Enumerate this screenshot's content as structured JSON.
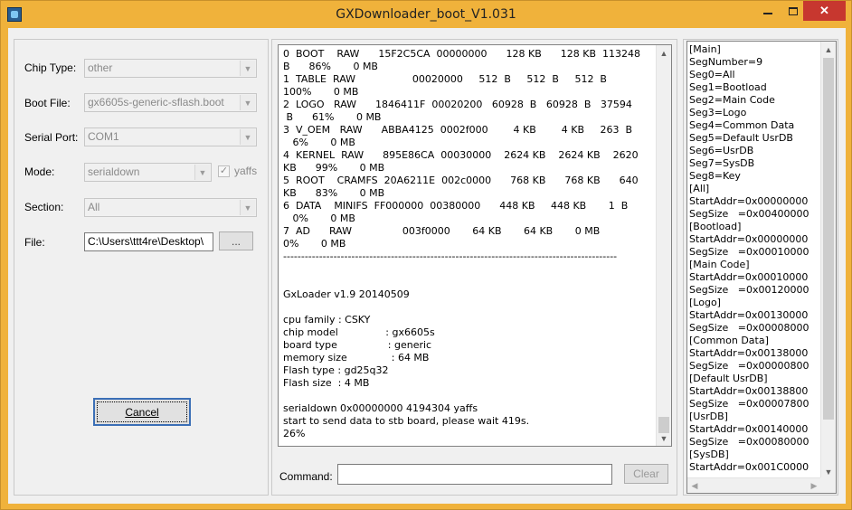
{
  "window": {
    "title": "GXDownloader_boot_V1.031",
    "minimize_label": "",
    "close_label": "✕"
  },
  "settings": {
    "chip_type_label": "Chip Type:",
    "chip_type_value": "other",
    "boot_file_label": "Boot File:",
    "boot_file_value": "gx6605s-generic-sflash.boot",
    "serial_port_label": "Serial Port:",
    "serial_port_value": "COM1",
    "mode_label": "Mode:",
    "mode_value": "serialdown",
    "yaffs_label": "yaffs",
    "yaffs_checked": true,
    "section_label": "Section:",
    "section_value": "All",
    "file_label": "File:",
    "file_value": "C:\\Users\\ttt4re\\Desktop\\",
    "browse_label": "...",
    "cancel_label": "Cancel"
  },
  "log": {
    "lines": [
      "0  BOOT    RAW      15F2C5CA  00000000      128 KB      128 KB  113248",
      "B      86%       0 MB",
      "1  TABLE  RAW                  00020000     512  B     512  B     512  B",
      "100%       0 MB",
      "2  LOGO   RAW      1846411F  00020200   60928  B   60928  B   37594",
      " B      61%       0 MB",
      "3  V_OEM   RAW      ABBA4125  0002f000        4 KB        4 KB     263  B",
      "   6%       0 MB",
      "4  KERNEL  RAW      895E86CA  00030000    2624 KB    2624 KB    2620",
      "KB      99%       0 MB",
      "5  ROOT    CRAMFS  20A6211E  002c0000      768 KB      768 KB      640",
      "KB      83%       0 MB",
      "6  DATA    MINIFS  FF000000  00380000      448 KB     448 KB       1  B",
      "   0%       0 MB",
      "7  AD      RAW                003f0000       64 KB       64 KB       0 MB",
      "0%       0 MB",
      "---------------------------------------------------------------------------------------------",
      "",
      "",
      "GxLoader v1.9 20140509",
      "",
      "cpu family : CSKY",
      "chip model               : gx6605s",
      "board type                : generic",
      "memory size              : 64 MB",
      "Flash type : gd25q32",
      "Flash size  : 4 MB",
      "",
      "serialdown 0x00000000 4194304 yaffs",
      "start to send data to stb board, please wait 419s.",
      "26%"
    ]
  },
  "command": {
    "label": "Command:",
    "value": "",
    "clear_label": "Clear"
  },
  "config": {
    "lines": [
      "[Main]",
      "SegNumber=9",
      "Seg0=All",
      "Seg1=Bootload",
      "Seg2=Main Code",
      "Seg3=Logo",
      "Seg4=Common Data",
      "Seg5=Default UsrDB",
      "Seg6=UsrDB",
      "Seg7=SysDB",
      "Seg8=Key",
      "[All]",
      "StartAddr=0x00000000",
      "SegSize   =0x00400000",
      "[Bootload]",
      "StartAddr=0x00000000",
      "SegSize   =0x00010000",
      "[Main Code]",
      "StartAddr=0x00010000",
      "SegSize   =0x00120000",
      "[Logo]",
      "StartAddr=0x00130000",
      "SegSize   =0x00008000",
      "[Common Data]",
      "StartAddr=0x00138000",
      "SegSize   =0x00000800",
      "[Default UsrDB]",
      "StartAddr=0x00138800",
      "SegSize   =0x00007800",
      "[UsrDB]",
      "StartAddr=0x00140000",
      "SegSize   =0x00080000",
      "[SysDB]",
      "StartAddr=0x001C0000"
    ]
  },
  "colors": {
    "titlebar": "#f0b23b",
    "close": "#c7372f",
    "focus": "#3b6fb6"
  }
}
